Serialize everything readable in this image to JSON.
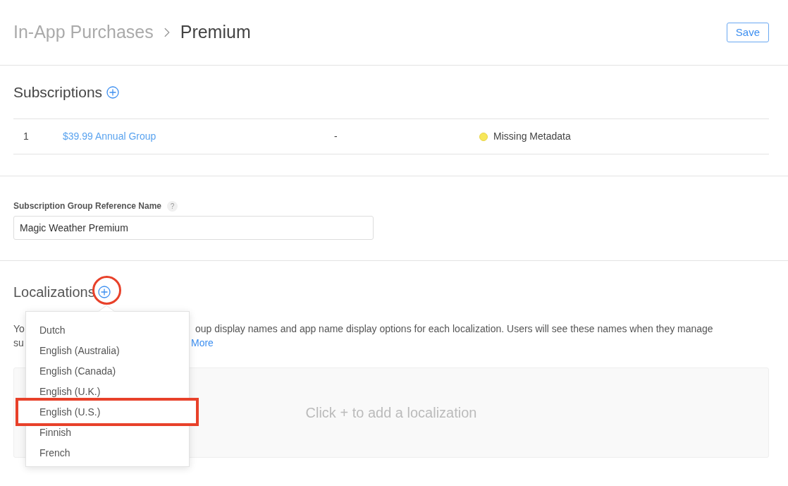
{
  "header": {
    "breadcrumb": "In-App Purchases",
    "title": "Premium",
    "save": "Save"
  },
  "subscriptions": {
    "title": "Subscriptions",
    "rows": [
      {
        "rank": "1",
        "name": "$39.99 Annual Group",
        "column_3": "-",
        "status": "Missing Metadata",
        "color": "#f7e75a"
      }
    ]
  },
  "reference_name": {
    "label": "Subscription Group Reference Name",
    "help": "?",
    "value": "Magic Weather Premium"
  },
  "localizations": {
    "title": "Localizations",
    "add_circled": true,
    "description_lines": [
      {
        "start": "Yo",
        "rest": "oup display names and app name display options for each localization. Users will see these names when they manage"
      },
      {
        "start": "su",
        "link": "More"
      }
    ],
    "empty_text": "Click + to add a localization",
    "menu": {
      "items": [
        {
          "label": "Dutch",
          "highlighted": false
        },
        {
          "label": "English (Australia)",
          "highlighted": false
        },
        {
          "label": "English (Canada)",
          "highlighted": false
        },
        {
          "label": "English (U.K.)",
          "highlighted": false
        },
        {
          "label": "English (U.S.)",
          "highlighted": true
        },
        {
          "label": "Finnish",
          "highlighted": false
        },
        {
          "label": "French",
          "highlighted": false
        }
      ]
    }
  }
}
